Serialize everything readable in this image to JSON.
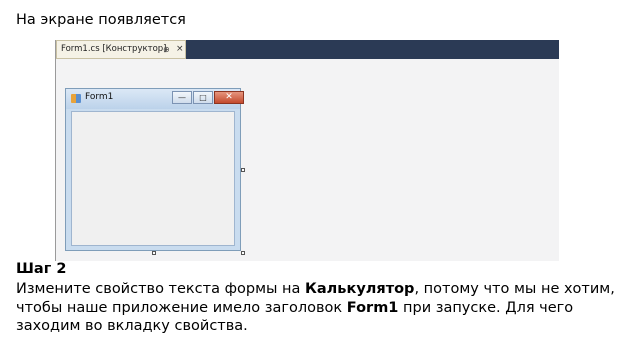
{
  "intro": "На экране появляется",
  "screenshot": {
    "tab_label": "Form1.cs [Конструктор]",
    "tab_pin": "⊕",
    "tab_close": "×",
    "form_title": "Form1",
    "minimize": "—",
    "maximize": "□",
    "close": "✕"
  },
  "step": "Шаг 2",
  "paragraph": {
    "part1": "Измените свойство текста формы на ",
    "bold1": "Калькулятор",
    "part2": ", потому что мы не хотим, чтобы наше приложение имело заголовок ",
    "bold2": "Form1",
    "part3": " при запуске. Для чего заходим во вкладку свойства."
  },
  "colors": {
    "tabbar": "#2b3a55",
    "designer_bg": "#f3f3f4",
    "close_button": "#c34a2d"
  }
}
